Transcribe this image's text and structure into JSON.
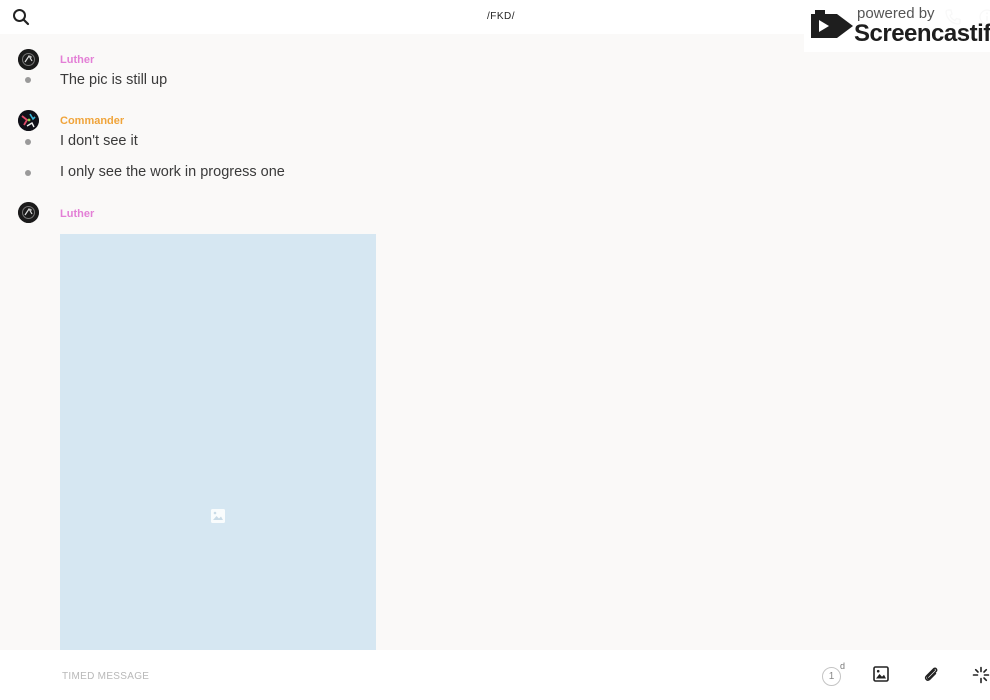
{
  "header": {
    "channel_title": "/FKD/"
  },
  "watermark": {
    "powered_by": "powered by",
    "brand": "Screencastify"
  },
  "messages": [
    {
      "author": "Luther",
      "author_color": "#e37fd6",
      "lines": [
        "The pic is still up"
      ]
    },
    {
      "author": "Commander",
      "author_color": "#f0a43a",
      "lines": [
        "I don't see it",
        "I only see the work in progress one"
      ]
    },
    {
      "author": "Luther",
      "author_color": "#e37fd6",
      "lines": [],
      "has_image": true
    }
  ],
  "composer": {
    "placeholder": "TIMED MESSAGE",
    "value": ""
  },
  "timer": {
    "value": "1",
    "unit": "d"
  },
  "icons": {
    "search": "search-icon",
    "call": "phone-icon",
    "info": "info-icon",
    "image_placeholder": "image-icon",
    "photo": "photo-icon",
    "attach": "paperclip-icon",
    "sparkle": "sparkle-icon"
  },
  "colors": {
    "background": "#faf9f8",
    "image_placeholder": "#d6e7f2",
    "luther": "#e37fd6",
    "commander": "#f0a43a"
  }
}
